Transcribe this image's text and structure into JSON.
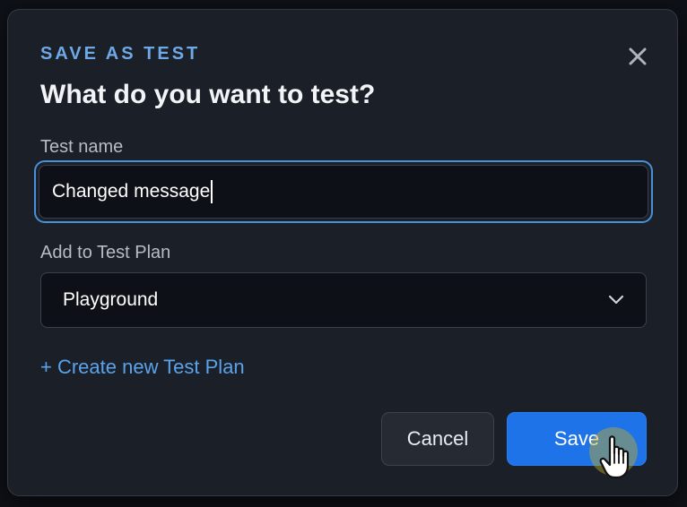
{
  "dialog": {
    "eyebrow": "SAVE AS TEST",
    "title": "What do you want to test?",
    "close_icon": "close-icon"
  },
  "test_name": {
    "label": "Test name",
    "value": "Changed message"
  },
  "test_plan": {
    "label": "Add to Test Plan",
    "selected": "Playground",
    "chevron_icon": "chevron-down-icon"
  },
  "create_link": "+ Create new Test Plan",
  "actions": {
    "cancel_label": "Cancel",
    "save_label": "Save"
  },
  "colors": {
    "accent": "#1f73e8",
    "eyebrow": "#6fa8e6",
    "link": "#5aa3ec",
    "focus_ring": "#4a8fd8",
    "modal_bg": "#1b1f27"
  },
  "cursor": "pointer-hand-icon"
}
